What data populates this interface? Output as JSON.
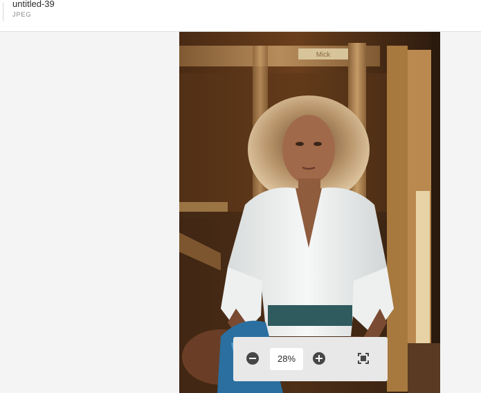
{
  "file": {
    "name": "untitled-39",
    "type": "JPEG"
  },
  "image": {
    "description_icon": "photo-preview",
    "colors": {
      "wood_dark": "#3a2414",
      "wood_mid": "#6b4424",
      "wood_light": "#c49a66",
      "shirt": "#eef0f0",
      "skin": "#9b6648",
      "hair": "#c8a882",
      "paint_blue": "#2a6fa0"
    },
    "sign_text": "Mick"
  },
  "zoom": {
    "value": "28%",
    "out_icon": "zoom-out-icon",
    "in_icon": "zoom-in-icon",
    "fit_icon": "fit-to-screen-icon"
  }
}
